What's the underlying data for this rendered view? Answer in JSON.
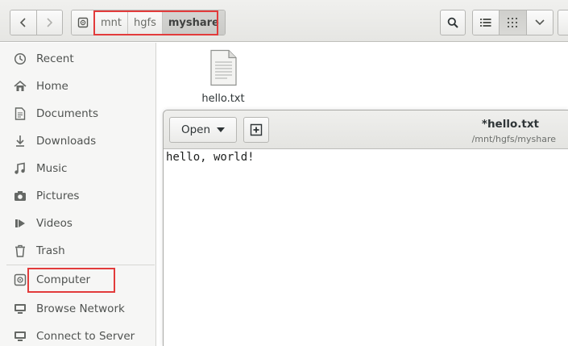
{
  "headerbar": {
    "path": [
      {
        "label": "mnt"
      },
      {
        "label": "hgfs"
      },
      {
        "label": "myshare"
      }
    ]
  },
  "sidebar": {
    "items": [
      {
        "label": "Recent",
        "icon": "clock-icon"
      },
      {
        "label": "Home",
        "icon": "home-icon"
      },
      {
        "label": "Documents",
        "icon": "document-icon"
      },
      {
        "label": "Downloads",
        "icon": "download-icon"
      },
      {
        "label": "Music",
        "icon": "music-icon"
      },
      {
        "label": "Pictures",
        "icon": "camera-icon"
      },
      {
        "label": "Videos",
        "icon": "video-icon"
      },
      {
        "label": "Trash",
        "icon": "trash-icon"
      },
      {
        "label": "Computer",
        "icon": "drive-icon"
      },
      {
        "label": "Browse Network",
        "icon": "network-icon"
      },
      {
        "label": "Connect to Server",
        "icon": "server-icon"
      }
    ]
  },
  "files": [
    {
      "name": "hello.txt"
    }
  ],
  "editor": {
    "open_label": "Open",
    "title": "*hello.txt",
    "subtitle": "/mnt/hgfs/myshare",
    "content": "hello, world!"
  },
  "colors": {
    "highlight": "#e23b3b"
  }
}
